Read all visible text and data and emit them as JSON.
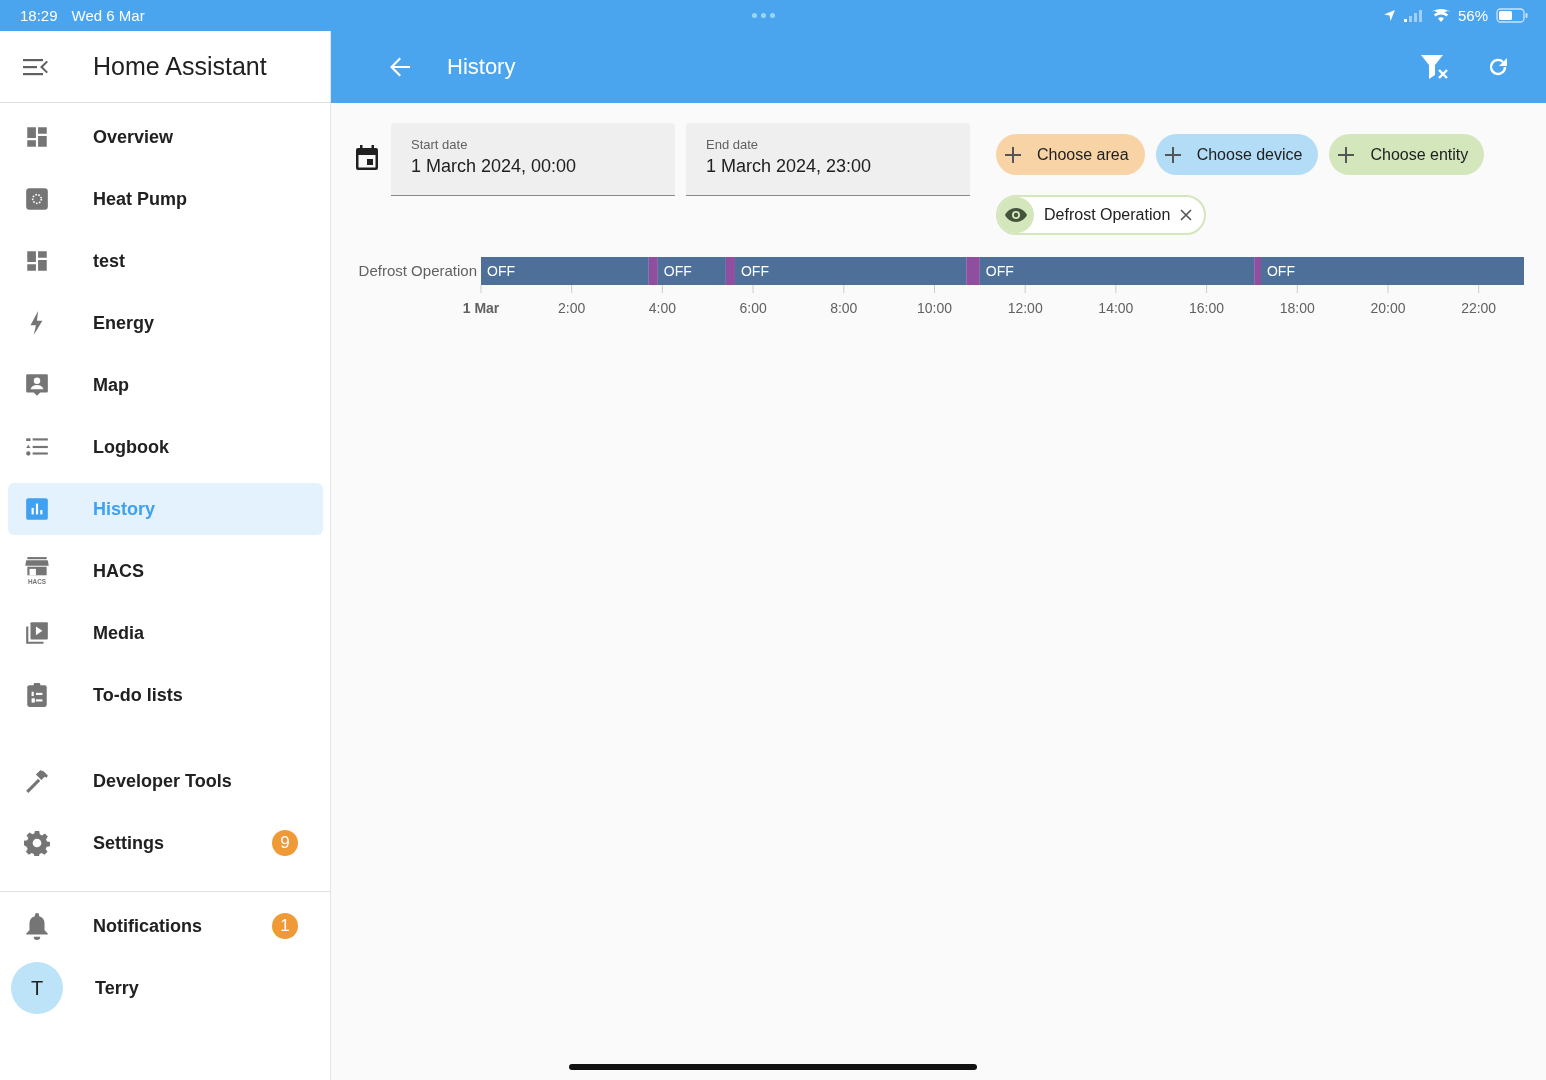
{
  "status_bar": {
    "time": "18:29",
    "date": "Wed 6 Mar",
    "battery": "56%"
  },
  "sidebar": {
    "title": "Home Assistant",
    "items": [
      {
        "label": "Overview",
        "selected": false
      },
      {
        "label": "Heat Pump",
        "selected": false
      },
      {
        "label": "test",
        "selected": false
      },
      {
        "label": "Energy",
        "selected": false
      },
      {
        "label": "Map",
        "selected": false
      },
      {
        "label": "Logbook",
        "selected": false
      },
      {
        "label": "History",
        "selected": true
      },
      {
        "label": "HACS",
        "selected": false,
        "icon_caption": "HACS"
      },
      {
        "label": "Media",
        "selected": false
      },
      {
        "label": "To-do lists",
        "selected": false
      }
    ],
    "tools": [
      {
        "label": "Developer Tools",
        "selected": false
      },
      {
        "label": "Settings",
        "selected": false,
        "badge": "9"
      }
    ],
    "notifications": {
      "label": "Notifications",
      "badge": "1"
    },
    "user": {
      "initial": "T",
      "name": "Terry"
    }
  },
  "header": {
    "title": "History"
  },
  "date_range": {
    "start": {
      "label": "Start date",
      "value": "1 March 2024, 00:00"
    },
    "end": {
      "label": "End date",
      "value": "1 March 2024, 23:00"
    }
  },
  "target_pickers": [
    {
      "label": "Choose area",
      "color": "#f8d3a6"
    },
    {
      "label": "Choose device",
      "color": "#b3dcf6"
    },
    {
      "label": "Choose entity",
      "color": "#d3e6bc"
    }
  ],
  "selected_entities": [
    {
      "label": "Defrost Operation"
    }
  ],
  "timeline": {
    "chart_data": {
      "type": "bar",
      "orientation": "horizontal",
      "stacked": true,
      "categories": [
        "Defrost Operation"
      ],
      "xlim": [
        0,
        23
      ],
      "xticks": [
        {
          "value": 0,
          "label": "1 Mar"
        },
        {
          "value": 2,
          "label": "2:00"
        },
        {
          "value": 4,
          "label": "4:00"
        },
        {
          "value": 6,
          "label": "6:00"
        },
        {
          "value": 8,
          "label": "8:00"
        },
        {
          "value": 10,
          "label": "10:00"
        },
        {
          "value": 12,
          "label": "12:00"
        },
        {
          "value": 14,
          "label": "14:00"
        },
        {
          "value": 16,
          "label": "16:00"
        },
        {
          "value": 18,
          "label": "18:00"
        },
        {
          "value": 20,
          "label": "20:00"
        },
        {
          "value": 22,
          "label": "22:00"
        }
      ],
      "series": [
        {
          "color": "#4e6f98",
          "values": [
            3.7
          ],
          "value_labels": [
            "OFF"
          ]
        },
        {
          "color": "#8f4e9e",
          "values": [
            0.2
          ],
          "value_labels": [
            null
          ]
        },
        {
          "color": "#4e6f98",
          "values": [
            1.5
          ],
          "value_labels": [
            "OFF"
          ]
        },
        {
          "color": "#8f4e9e",
          "values": [
            0.2
          ],
          "value_labels": [
            null
          ]
        },
        {
          "color": "#4e6f98",
          "values": [
            5.1
          ],
          "value_labels": [
            "OFF"
          ]
        },
        {
          "color": "#8f4e9e",
          "values": [
            0.3
          ],
          "value_labels": [
            null
          ]
        },
        {
          "color": "#4e6f98",
          "values": [
            6.05
          ],
          "value_labels": [
            "OFF"
          ]
        },
        {
          "color": "#8f4e9e",
          "values": [
            0.15
          ],
          "value_labels": [
            null
          ]
        },
        {
          "color": "#4e6f98",
          "values": [
            5.8
          ],
          "value_labels": [
            "OFF"
          ]
        }
      ]
    }
  }
}
